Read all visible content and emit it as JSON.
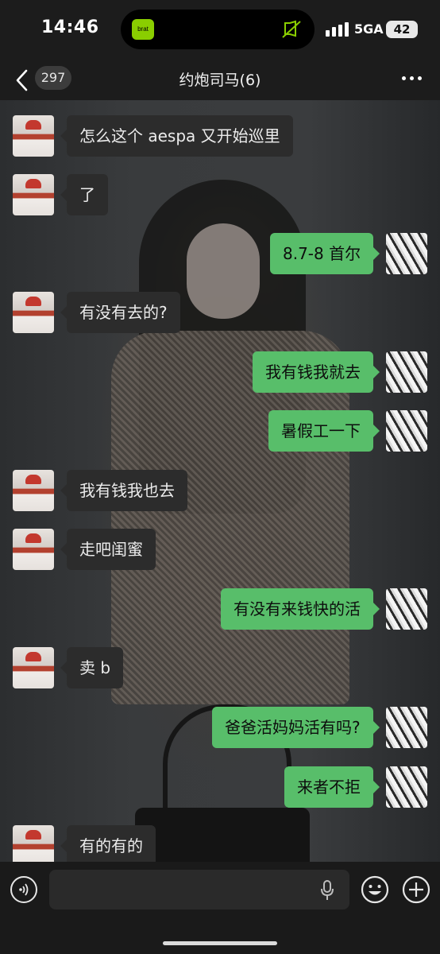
{
  "status_bar": {
    "time": "14:46",
    "island_app_label": "brat",
    "network": "5GA",
    "battery": "42"
  },
  "header": {
    "unread_count": "297",
    "title": "约炮司马(6)"
  },
  "colors": {
    "sent_bubble": "#58be6a",
    "received_bubble": "#2c2c2c",
    "background": "#1c1c1c"
  },
  "messages": [
    {
      "side": "left",
      "text": "怎么这个 aespa 又开始巡里"
    },
    {
      "side": "left",
      "text": "了"
    },
    {
      "side": "right",
      "text": "8.7-8 首尔"
    },
    {
      "side": "left",
      "text": "有没有去的?"
    },
    {
      "side": "right",
      "text": "我有钱我就去"
    },
    {
      "side": "right",
      "text": "暑假工一下"
    },
    {
      "side": "left",
      "text": "我有钱我也去"
    },
    {
      "side": "left",
      "text": "走吧闺蜜"
    },
    {
      "side": "right",
      "text": "有没有来钱快的活"
    },
    {
      "side": "left",
      "text": "卖 b"
    },
    {
      "side": "right",
      "text": "爸爸活妈妈活有吗?"
    },
    {
      "side": "right",
      "text": "来者不拒"
    },
    {
      "side": "left",
      "text": "有的有的"
    }
  ],
  "input": {
    "value": ""
  },
  "icons": [
    "back-chevron-icon",
    "more-dots-icon",
    "voice-icon",
    "mic-icon",
    "emoji-icon",
    "plus-icon",
    "mute-icon"
  ]
}
